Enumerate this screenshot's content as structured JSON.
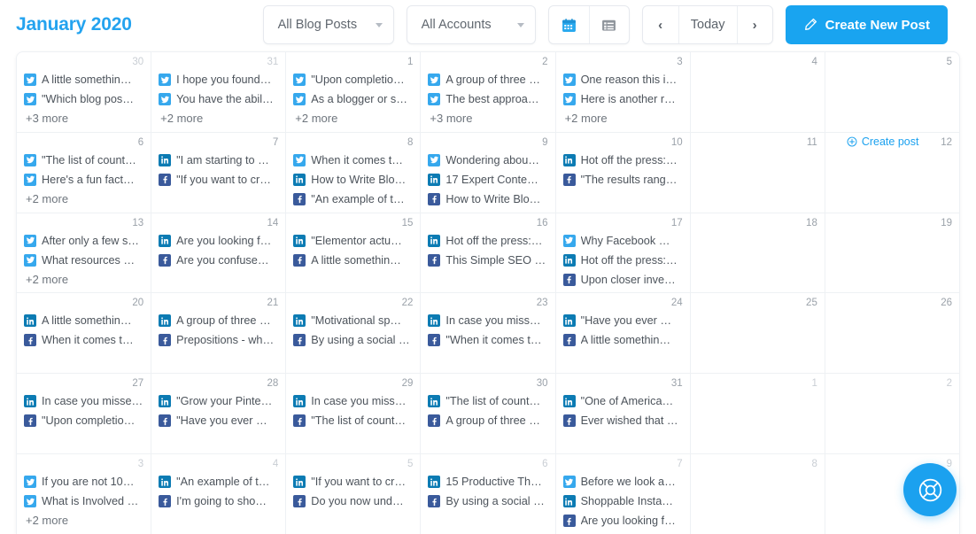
{
  "toolbar": {
    "month_title": "January 2020",
    "blog_filter": {
      "label": "All Blog Posts",
      "icon": "chevron-down-icon"
    },
    "account_filter": {
      "label": "All Accounts",
      "icon": "chevron-down-icon"
    },
    "calendar_view_icon": "calendar-icon",
    "list_view_icon": "list-icon",
    "prev_label": "‹",
    "today_label": "Today",
    "next_label": "›",
    "create_label": "Create New Post",
    "create_icon": "pencil-icon",
    "accent_color": "#19a4f0",
    "title_color": "#24a3ef"
  },
  "hover_cell": {
    "label": "Create post",
    "icon": "plus-circle-icon"
  },
  "fab": {
    "icon": "lifebuoy-icon",
    "color": "#1ba1ef"
  },
  "network_colors": {
    "twitter": "#36a8ed",
    "linkedin": "#0c7bb3",
    "facebook": "#3a5a9b"
  },
  "weeks": [
    [
      {
        "daynum": "30",
        "muted": true,
        "events": [
          {
            "network": "twitter",
            "label": "A little somethin…"
          },
          {
            "network": "twitter",
            "label": "\"Which blog pos…"
          }
        ],
        "more": "+3 more"
      },
      {
        "daynum": "31",
        "muted": true,
        "events": [
          {
            "network": "twitter",
            "label": "I hope you found…"
          },
          {
            "network": "twitter",
            "label": "You have the abil…"
          }
        ],
        "more": "+2 more"
      },
      {
        "daynum": "1",
        "muted": false,
        "events": [
          {
            "network": "twitter",
            "label": "\"Upon completio…"
          },
          {
            "network": "twitter",
            "label": "As a blogger or s…"
          }
        ],
        "more": "+2 more"
      },
      {
        "daynum": "2",
        "muted": false,
        "events": [
          {
            "network": "twitter",
            "label": "A group of three …"
          },
          {
            "network": "twitter",
            "label": "The best approa…"
          }
        ],
        "more": "+3 more"
      },
      {
        "daynum": "3",
        "muted": false,
        "events": [
          {
            "network": "twitter",
            "label": "One reason this i…"
          },
          {
            "network": "twitter",
            "label": "Here is another r…"
          }
        ],
        "more": "+2 more"
      },
      {
        "daynum": "4",
        "muted": false,
        "events": [],
        "more": ""
      },
      {
        "daynum": "5",
        "muted": false,
        "events": [],
        "more": ""
      }
    ],
    [
      {
        "daynum": "6",
        "muted": false,
        "events": [
          {
            "network": "twitter",
            "label": "\"The list of count…"
          },
          {
            "network": "twitter",
            "label": "Here's a fun fact…"
          }
        ],
        "more": "+2 more"
      },
      {
        "daynum": "7",
        "muted": false,
        "events": [
          {
            "network": "linkedin",
            "label": "\"I am starting to …"
          },
          {
            "network": "facebook",
            "label": "\"If you want to cr…"
          }
        ],
        "more": ""
      },
      {
        "daynum": "8",
        "muted": false,
        "events": [
          {
            "network": "twitter",
            "label": "When it comes t…"
          },
          {
            "network": "linkedin",
            "label": "How to Write Blo…"
          },
          {
            "network": "facebook",
            "label": "\"An example of t…"
          }
        ],
        "more": ""
      },
      {
        "daynum": "9",
        "muted": false,
        "events": [
          {
            "network": "twitter",
            "label": "Wondering abou…"
          },
          {
            "network": "linkedin",
            "label": "17 Expert Conte…"
          },
          {
            "network": "facebook",
            "label": "How to Write Blo…"
          }
        ],
        "more": ""
      },
      {
        "daynum": "10",
        "muted": false,
        "events": [
          {
            "network": "linkedin",
            "label": "Hot off the press:…"
          },
          {
            "network": "facebook",
            "label": "\"The results rang…"
          }
        ],
        "more": ""
      },
      {
        "daynum": "11",
        "muted": false,
        "events": [],
        "more": ""
      },
      {
        "daynum": "12",
        "muted": false,
        "events": [],
        "more": "",
        "hover": true
      }
    ],
    [
      {
        "daynum": "13",
        "muted": false,
        "events": [
          {
            "network": "twitter",
            "label": "After only a few s…"
          },
          {
            "network": "twitter",
            "label": "What resources …"
          }
        ],
        "more": "+2 more"
      },
      {
        "daynum": "14",
        "muted": false,
        "events": [
          {
            "network": "linkedin",
            "label": "Are you looking f…"
          },
          {
            "network": "facebook",
            "label": "Are you confuse…"
          }
        ],
        "more": ""
      },
      {
        "daynum": "15",
        "muted": false,
        "events": [
          {
            "network": "linkedin",
            "label": "\"Elementor actu…"
          },
          {
            "network": "facebook",
            "label": "A little somethin…"
          }
        ],
        "more": ""
      },
      {
        "daynum": "16",
        "muted": false,
        "events": [
          {
            "network": "linkedin",
            "label": "Hot off the press:…"
          },
          {
            "network": "facebook",
            "label": "This Simple SEO …"
          }
        ],
        "more": ""
      },
      {
        "daynum": "17",
        "muted": false,
        "events": [
          {
            "network": "twitter",
            "label": "Why Facebook …"
          },
          {
            "network": "linkedin",
            "label": "Hot off the press:…"
          },
          {
            "network": "facebook",
            "label": "Upon closer inve…"
          }
        ],
        "more": ""
      },
      {
        "daynum": "18",
        "muted": false,
        "events": [],
        "more": ""
      },
      {
        "daynum": "19",
        "muted": false,
        "events": [],
        "more": ""
      }
    ],
    [
      {
        "daynum": "20",
        "muted": false,
        "events": [
          {
            "network": "linkedin",
            "label": "A little somethin…"
          },
          {
            "network": "facebook",
            "label": "When it comes t…"
          }
        ],
        "more": ""
      },
      {
        "daynum": "21",
        "muted": false,
        "events": [
          {
            "network": "linkedin",
            "label": "A group of three …"
          },
          {
            "network": "facebook",
            "label": "Prepositions - wh…"
          }
        ],
        "more": ""
      },
      {
        "daynum": "22",
        "muted": false,
        "events": [
          {
            "network": "linkedin",
            "label": "\"Motivational sp…"
          },
          {
            "network": "facebook",
            "label": "By using a social …"
          }
        ],
        "more": ""
      },
      {
        "daynum": "23",
        "muted": false,
        "events": [
          {
            "network": "linkedin",
            "label": "In case you miss…"
          },
          {
            "network": "facebook",
            "label": "\"When it comes t…"
          }
        ],
        "more": ""
      },
      {
        "daynum": "24",
        "muted": false,
        "events": [
          {
            "network": "linkedin",
            "label": "\"Have you ever …"
          },
          {
            "network": "facebook",
            "label": "A little somethin…"
          }
        ],
        "more": ""
      },
      {
        "daynum": "25",
        "muted": false,
        "events": [],
        "more": ""
      },
      {
        "daynum": "26",
        "muted": false,
        "events": [],
        "more": ""
      }
    ],
    [
      {
        "daynum": "27",
        "muted": false,
        "events": [
          {
            "network": "linkedin",
            "label": "In case you misse…"
          },
          {
            "network": "facebook",
            "label": "\"Upon completio…"
          }
        ],
        "more": ""
      },
      {
        "daynum": "28",
        "muted": false,
        "events": [
          {
            "network": "linkedin",
            "label": "\"Grow your Pinte…"
          },
          {
            "network": "facebook",
            "label": "\"Have you ever …"
          }
        ],
        "more": ""
      },
      {
        "daynum": "29",
        "muted": false,
        "events": [
          {
            "network": "linkedin",
            "label": "In case you miss…"
          },
          {
            "network": "facebook",
            "label": "\"The list of count…"
          }
        ],
        "more": ""
      },
      {
        "daynum": "30",
        "muted": false,
        "events": [
          {
            "network": "linkedin",
            "label": "\"The list of count…"
          },
          {
            "network": "facebook",
            "label": "A group of three …"
          }
        ],
        "more": ""
      },
      {
        "daynum": "31",
        "muted": false,
        "events": [
          {
            "network": "linkedin",
            "label": "\"One of America…"
          },
          {
            "network": "facebook",
            "label": "Ever wished that …"
          }
        ],
        "more": ""
      },
      {
        "daynum": "1",
        "muted": true,
        "events": [],
        "more": ""
      },
      {
        "daynum": "2",
        "muted": true,
        "events": [],
        "more": ""
      }
    ],
    [
      {
        "daynum": "3",
        "muted": true,
        "events": [
          {
            "network": "twitter",
            "label": "If you are not 10…"
          },
          {
            "network": "twitter",
            "label": "What is Involved …"
          }
        ],
        "more": "+2 more"
      },
      {
        "daynum": "4",
        "muted": true,
        "events": [
          {
            "network": "linkedin",
            "label": "\"An example of t…"
          },
          {
            "network": "facebook",
            "label": "I'm going to sho…"
          }
        ],
        "more": ""
      },
      {
        "daynum": "5",
        "muted": true,
        "events": [
          {
            "network": "linkedin",
            "label": "\"If you want to cr…"
          },
          {
            "network": "facebook",
            "label": "Do you now und…"
          }
        ],
        "more": ""
      },
      {
        "daynum": "6",
        "muted": true,
        "events": [
          {
            "network": "linkedin",
            "label": "15 Productive Th…"
          },
          {
            "network": "facebook",
            "label": "By using a social …"
          }
        ],
        "more": ""
      },
      {
        "daynum": "7",
        "muted": true,
        "events": [
          {
            "network": "twitter",
            "label": "Before we look a…"
          },
          {
            "network": "linkedin",
            "label": "Shoppable Insta…"
          },
          {
            "network": "facebook",
            "label": "Are you looking f…"
          }
        ],
        "more": ""
      },
      {
        "daynum": "8",
        "muted": true,
        "events": [],
        "more": ""
      },
      {
        "daynum": "9",
        "muted": true,
        "events": [],
        "more": ""
      }
    ]
  ]
}
